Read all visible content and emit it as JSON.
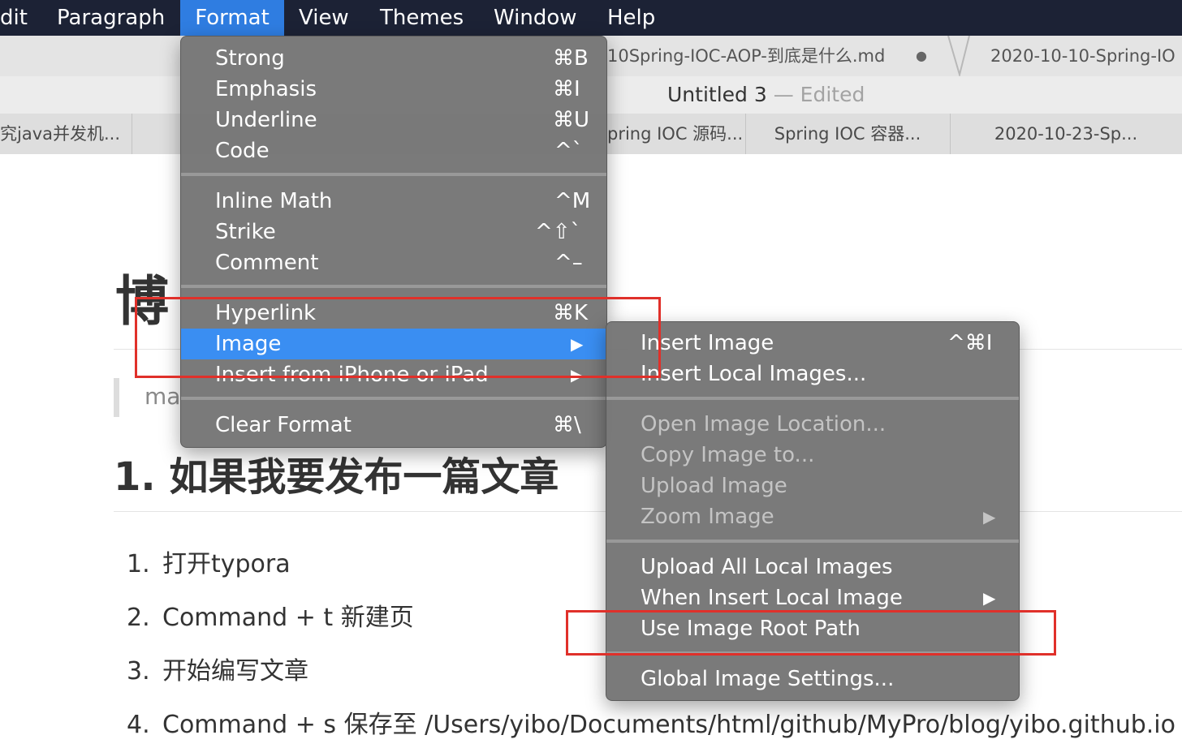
{
  "menubar": {
    "items": [
      "dit",
      "Paragraph",
      "Format",
      "View",
      "Themes",
      "Window",
      "Help"
    ],
    "active": "Format"
  },
  "window": {
    "file_tabs": [
      "10Spring-IOC-AOP-到底是什么.md",
      "2020-10-10-Spring-IO"
    ],
    "unsaved_dot": "●",
    "title": "Untitled 3",
    "title_separator": "—",
    "title_status": "Edited",
    "doc_tabs": [
      "究java并发机...",
      "pring IOC 源码...",
      "Spring IOC 容器...",
      "2020-10-23-Sp..."
    ]
  },
  "document": {
    "heading": "博",
    "quote": "ma",
    "section_heading": "1. 如果我要发布一篇文章",
    "list": [
      {
        "num": "1.",
        "text": "打开typora"
      },
      {
        "num": "2.",
        "text": "Command + t 新建页"
      },
      {
        "num": "3.",
        "text": "开始编写文章"
      },
      {
        "num": "4.",
        "text": "Command + s 保存至 /Users/yibo/Documents/html/github/MyPro/blog/yibo.github.io"
      }
    ]
  },
  "format_menu": {
    "items": [
      {
        "label": "Strong",
        "shortcut": "⌘B"
      },
      {
        "label": "Emphasis",
        "shortcut": "⌘I"
      },
      {
        "label": "Underline",
        "shortcut": "⌘U"
      },
      {
        "label": "Code",
        "shortcut": "^`"
      },
      {
        "label": "Inline Math",
        "shortcut": "^M"
      },
      {
        "label": "Strike",
        "shortcut": "^⇧`"
      },
      {
        "label": "Comment",
        "shortcut": "^–"
      },
      {
        "label": "Hyperlink",
        "shortcut": "⌘K"
      },
      {
        "label": "Image",
        "shortcut": "▶"
      },
      {
        "label": "Insert from iPhone or iPad",
        "shortcut": "▶"
      },
      {
        "label": "Clear Format",
        "shortcut": "⌘\\"
      }
    ],
    "highlighted": "Image"
  },
  "image_submenu": {
    "items": [
      {
        "label": "Insert Image",
        "shortcut": "^⌘I"
      },
      {
        "label": "Insert Local Images...",
        "shortcut": ""
      },
      {
        "label": "Open Image Location...",
        "shortcut": "",
        "disabled": true
      },
      {
        "label": "Copy Image to...",
        "shortcut": "",
        "disabled": true
      },
      {
        "label": "Upload Image",
        "shortcut": "",
        "disabled": true
      },
      {
        "label": "Zoom Image",
        "shortcut": "▶",
        "disabled": true
      },
      {
        "label": "Upload All Local Images",
        "shortcut": ""
      },
      {
        "label": "When Insert Local Image",
        "shortcut": "▶"
      },
      {
        "label": "Use Image Root Path",
        "shortcut": ""
      },
      {
        "label": "Global Image Settings...",
        "shortcut": ""
      }
    ]
  },
  "colors": {
    "menubar_bg": "#1c2235",
    "menu_highlight": "#3a8ef2",
    "annotation_red": "#e0302a"
  }
}
